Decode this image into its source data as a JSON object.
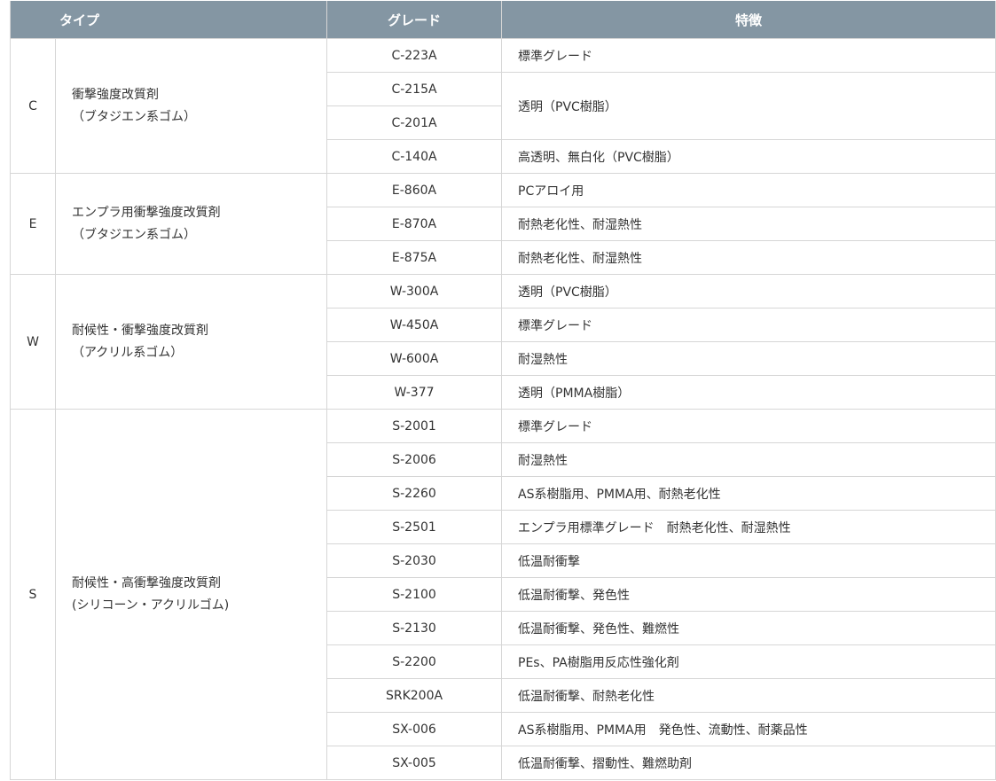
{
  "headers": {
    "type": "タイプ",
    "grade": "グレード",
    "feature": "特徴"
  },
  "groups": [
    {
      "code": "C",
      "desc_line1": "衝撃強度改質剤",
      "desc_line2": "（ブタジエン系ゴム）",
      "rows": [
        {
          "grade": "C-223A",
          "feature": "標準グレード"
        },
        {
          "grade": "C-215A",
          "feature": "透明（PVC樹脂）"
        },
        {
          "grade": "C-201A",
          "feature": ""
        },
        {
          "grade": "C-140A",
          "feature": "高透明、無白化（PVC樹脂）"
        }
      ]
    },
    {
      "code": "E",
      "desc_line1": "エンプラ用衝撃強度改質剤",
      "desc_line2": "（ブタジエン系ゴム）",
      "rows": [
        {
          "grade": "E-860A",
          "feature": "PCアロイ用"
        },
        {
          "grade": "E-870A",
          "feature": "耐熱老化性、耐湿熱性"
        },
        {
          "grade": "E-875A",
          "feature": "耐熱老化性、耐湿熱性"
        }
      ]
    },
    {
      "code": "W",
      "desc_line1": "耐候性・衝撃強度改質剤",
      "desc_line2": "（アクリル系ゴム）",
      "rows": [
        {
          "grade": "W-300A",
          "feature": "透明（PVC樹脂）"
        },
        {
          "grade": "W-450A",
          "feature": "標準グレード"
        },
        {
          "grade": "W-600A",
          "feature": "耐湿熱性"
        },
        {
          "grade": "W-377",
          "feature": "透明（PMMA樹脂）"
        }
      ]
    },
    {
      "code": "S",
      "desc_line1": "耐候性・高衝撃強度改質剤",
      "desc_line2": "(シリコーン・アクリルゴム)",
      "rows": [
        {
          "grade": "S-2001",
          "feature": "標準グレード"
        },
        {
          "grade": "S-2006",
          "feature": "耐湿熱性"
        },
        {
          "grade": "S-2260",
          "feature": "AS系樹脂用、PMMA用、耐熱老化性"
        },
        {
          "grade": "S-2501",
          "feature": "エンプラ用標準グレード　耐熱老化性、耐湿熱性"
        },
        {
          "grade": "S-2030",
          "feature": "低温耐衝撃"
        },
        {
          "grade": "S-2100",
          "feature": "低温耐衝撃、発色性"
        },
        {
          "grade": "S-2130",
          "feature": "低温耐衝撃、発色性、難燃性"
        },
        {
          "grade": "S-2200",
          "feature": "PEs、PA樹脂用反応性強化剤"
        },
        {
          "grade": "SRK200A",
          "feature": "低温耐衝撃、耐熱老化性"
        },
        {
          "grade": "SX-006",
          "feature": "AS系樹脂用、PMMA用　発色性、流動性、耐薬品性"
        },
        {
          "grade": "SX-005",
          "feature": "低温耐衝撃、摺動性、難燃助剤"
        }
      ]
    }
  ]
}
